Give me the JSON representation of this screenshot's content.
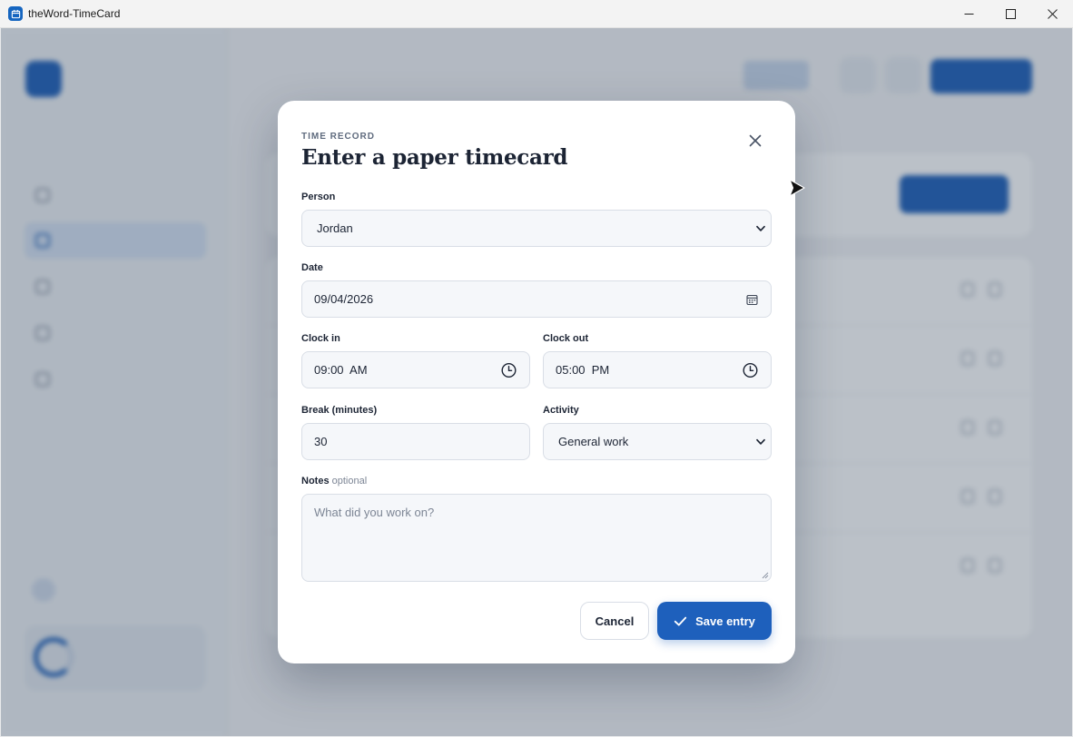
{
  "window": {
    "title": "theWord-TimeCard",
    "icon": "calendar-icon",
    "controls": [
      "minimize-icon",
      "maximize-icon",
      "close-icon"
    ]
  },
  "dialog": {
    "eyebrow": "TIME RECORD",
    "title": "Enter a paper timecard",
    "close_icon": "close-icon",
    "person": {
      "label": "Person",
      "value": "Jordan"
    },
    "date": {
      "label": "Date",
      "value": "09/04/2026",
      "icon": "calendar-icon"
    },
    "clock_in": {
      "label": "Clock in",
      "value": "09:00  AM",
      "icon": "clock-icon"
    },
    "clock_out": {
      "label": "Clock out",
      "value": "05:00  PM",
      "icon": "clock-icon"
    },
    "break": {
      "label": "Break (minutes)",
      "value": "30"
    },
    "activity": {
      "label": "Activity",
      "value": "General work"
    },
    "notes": {
      "label": "Notes",
      "optional": "optional",
      "placeholder": "What did you work on?",
      "value": ""
    },
    "cancel_label": "Cancel",
    "save_label": "Save entry",
    "save_icon": "check-icon"
  },
  "colors": {
    "accent": "#1e60bc",
    "overlay": "rgba(45,62,85,0.32)"
  }
}
